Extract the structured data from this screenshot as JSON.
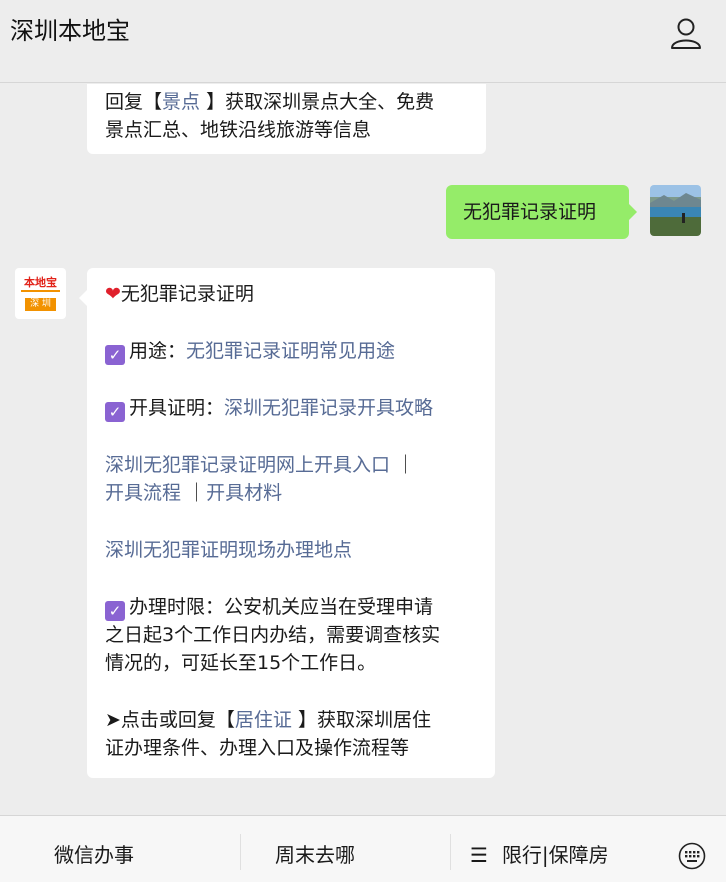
{
  "header": {
    "title": "深圳本地宝"
  },
  "messages": {
    "prev": {
      "line1_pre": "回复【",
      "keyword": "景点",
      "line1_post": " 】获取深圳景点大全、免费",
      "line2": "景点汇总、地铁沿线旅游等信息"
    },
    "user": {
      "text": "无犯罪记录证明"
    },
    "bot": {
      "logo_top": "本地宝",
      "logo_bottom": "深 圳",
      "title": "无犯罪记录证明",
      "heart": "❤",
      "check": "✓",
      "usage_label": "用途：",
      "usage_link": "无犯罪记录证明常见用途",
      "issue_label": "开具证明：",
      "issue_link": "深圳无犯罪记录开具攻略",
      "online_link": "深圳无犯罪记录证明网上开具入口",
      "sep1": " ｜",
      "process_link": "开具流程",
      "sep2": " ｜",
      "materials_link": "开具材料",
      "onsite_link": "深圳无犯罪证明现场办理地点",
      "time_label": "办理时限：",
      "time_l1": "公安机关应当在受理申请",
      "time_l2": "之日起3个工作日内办结，需要调查核实",
      "time_l3": "情况的，可延长至15个工作日。",
      "arrow_pre": "➤点击或回复【",
      "arrow_kw": "居住证",
      "arrow_post": " 】获取深圳居住",
      "arrow_l2": "证办理条件、办理入口及操作流程等"
    }
  },
  "menu": {
    "item1": "微信办事",
    "item2": "周末去哪",
    "item3_icon": "☰",
    "item3": "限行|保障房"
  }
}
